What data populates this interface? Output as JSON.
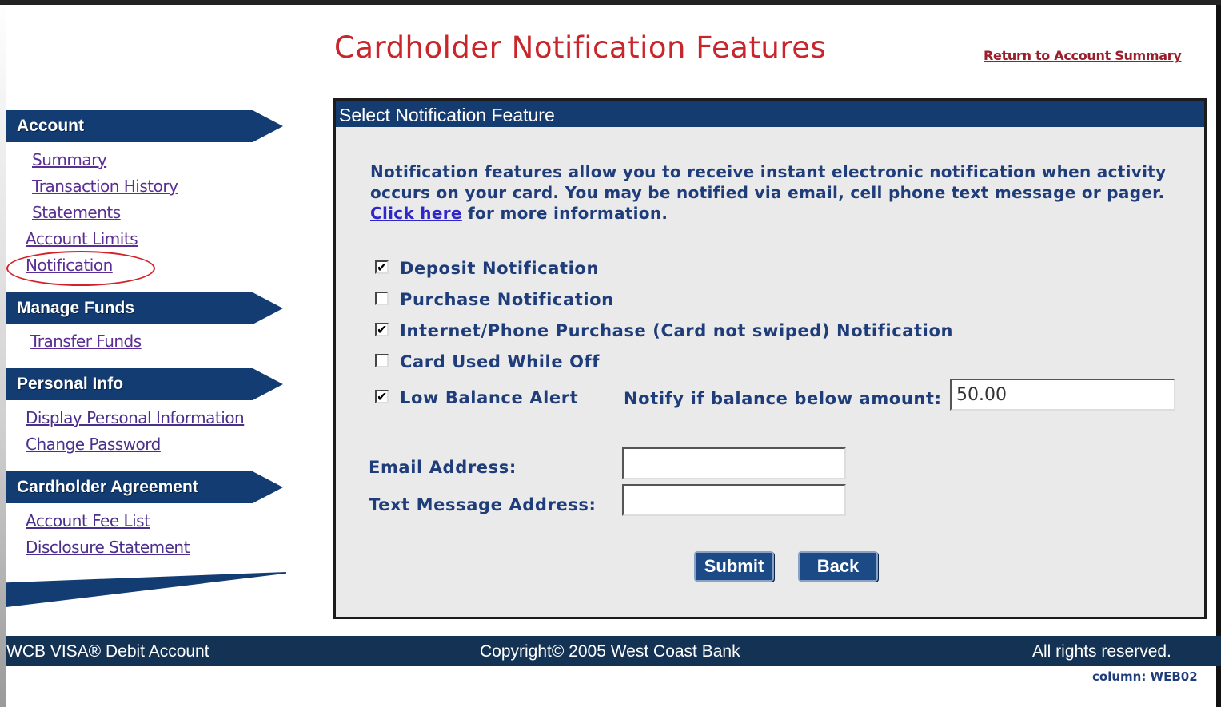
{
  "page": {
    "title": "Cardholder Notification Features",
    "return_link": "Return to Account Summary"
  },
  "sidebar": {
    "sections": [
      {
        "header": "Account",
        "links": [
          "Summary",
          "Transaction History",
          "Statements",
          "Account Limits",
          "Notification"
        ]
      },
      {
        "header": "Manage Funds",
        "links": [
          "Transfer Funds"
        ]
      },
      {
        "header": "Personal Info",
        "links": [
          "Display Personal Information",
          "Change Password"
        ]
      },
      {
        "header": "Cardholder Agreement",
        "links": [
          "Account Fee List",
          "Disclosure Statement"
        ]
      }
    ],
    "highlighted_link": "Notification"
  },
  "panel": {
    "header": "Select Notification Feature",
    "intro_text_1": "Notification features allow you to receive instant electronic notification when activity occurs on your card. You may be notified via email, cell phone text message or pager.",
    "intro_link": "Click here",
    "intro_text_2": "for more information.",
    "options": [
      {
        "label": "Deposit Notification",
        "checked": true
      },
      {
        "label": "Purchase Notification",
        "checked": false
      },
      {
        "label": "Internet/Phone Purchase (Card not swiped) Notification",
        "checked": true
      },
      {
        "label": "Card Used While Off",
        "checked": false
      },
      {
        "label": "Low Balance Alert",
        "checked": true
      }
    ],
    "balance_label": "Notify if balance below amount:",
    "balance_value": "50.00",
    "email_label": "Email Address:",
    "email_value": "",
    "text_label": "Text Message Address:",
    "text_value": "",
    "submit_label": "Submit",
    "back_label": "Back"
  },
  "footer": {
    "left": "WCB VISA® Debit Account",
    "center": "Copyright© 2005 West Coast Bank",
    "right": "All rights reserved.",
    "note": "column: WEB02"
  },
  "colors": {
    "nav_blue": "#123c72",
    "title_red": "#c8262a",
    "text_blue": "#1f3d7a",
    "highlight_circle": "#d42028"
  }
}
